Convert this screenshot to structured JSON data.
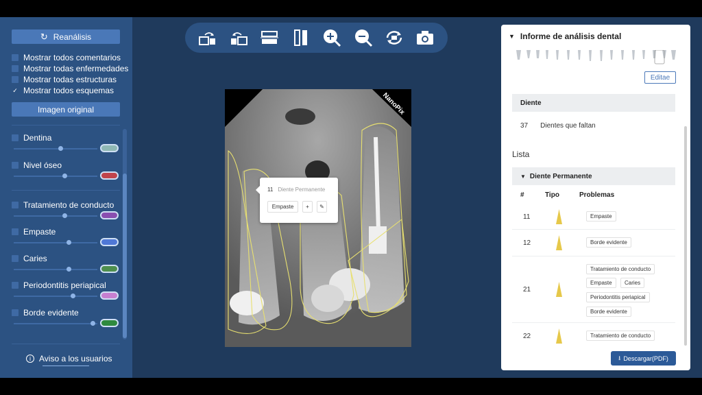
{
  "sidebar": {
    "reanalysis_label": "Reanálisis",
    "show_options": [
      {
        "label": "Mostrar todos comentarios",
        "checked": false
      },
      {
        "label": "Mostrar todas enfermedades",
        "checked": false
      },
      {
        "label": "Mostrar todas estructuras",
        "checked": false
      },
      {
        "label": "Mostrar todos esquemas",
        "checked": true
      }
    ],
    "original_image_label": "Imagen original",
    "layers": [
      {
        "label": "Dentina",
        "color": "#8fb8b4",
        "opacity": 0.55
      },
      {
        "label": "Nivel óseo",
        "color": "#c0444c",
        "opacity": 0.6
      },
      {
        "label": "Tratamiento de conducto",
        "color": "#8a4fb0",
        "opacity": 0.6
      },
      {
        "label": "Empaste",
        "color": "#4f78d6",
        "opacity": 0.65
      },
      {
        "label": "Caries",
        "color": "#4e8f4e",
        "opacity": 0.65
      },
      {
        "label": "Periodontitis periapical",
        "color": "#c67fd0",
        "opacity": 0.7
      },
      {
        "label": "Borde evidente",
        "color": "#2e8a3f",
        "opacity": 0.95
      }
    ],
    "notice_label": "Aviso a los usuarios"
  },
  "toolbar": {
    "tools": [
      "rotate-left-icon",
      "rotate-right-icon",
      "flip-horizontal-icon",
      "flip-vertical-icon",
      "zoom-in-icon",
      "zoom-out-icon",
      "reset-icon",
      "camera-icon"
    ]
  },
  "xray": {
    "watermark": "NanoPix"
  },
  "popup": {
    "tooth_number": "11",
    "tooth_type": "Diente Permanente",
    "tag": "Empaste",
    "add_symbol": "+"
  },
  "report": {
    "title": "Informe de análisis dental",
    "edit_label": "Editae",
    "tooth_header": "Diente",
    "missing_count": "37",
    "missing_label": "Dientes que faltan",
    "list_label": "Lista",
    "group_label": "Diente Permanente",
    "columns": {
      "num": "#",
      "type": "Tipo",
      "problems": "Problemas"
    },
    "rows": [
      {
        "num": "11",
        "problems": [
          "Empaste"
        ]
      },
      {
        "num": "12",
        "problems": [
          "Borde evidente"
        ]
      },
      {
        "num": "21",
        "problems": [
          "Tratamiento de conducto",
          "Empaste",
          "Caries",
          "Periodontitis periapical",
          "Borde evidente"
        ]
      },
      {
        "num": "22",
        "problems": [
          "Tratamiento de conducto"
        ]
      }
    ],
    "download_label": "Descargar(PDF)"
  },
  "colors": {
    "background": "#1f3a5c",
    "sidebar": "#2c5282",
    "accent": "#4a78b8",
    "tooth_icon": "#e6c84a"
  }
}
